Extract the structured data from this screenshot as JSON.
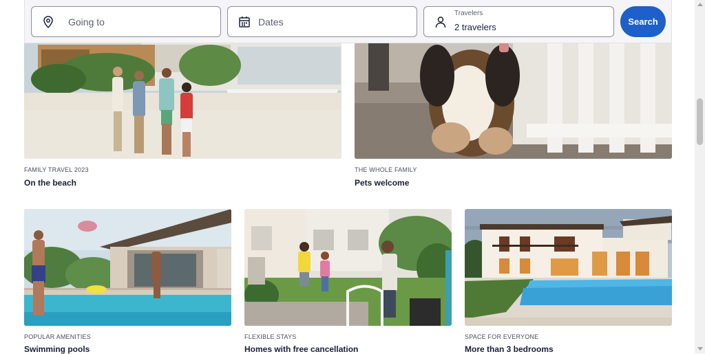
{
  "search": {
    "destination_placeholder": "Going to",
    "dates_label": "Dates",
    "travelers_label": "Travelers",
    "travelers_value": "2 travelers",
    "search_button": "Search"
  },
  "cards": [
    {
      "kicker": "FAMILY TRAVEL 2023",
      "title": "On the beach"
    },
    {
      "kicker": "THE WHOLE FAMILY",
      "title": "Pets welcome"
    },
    {
      "kicker": "POPULAR AMENITIES",
      "title": "Swimming pools"
    },
    {
      "kicker": "FLEXIBLE STAYS",
      "title": "Homes with free cancellation"
    },
    {
      "kicker": "SPACE FOR EVERYONE",
      "title": "More than 3 bedrooms"
    }
  ],
  "icons": {
    "destination": "map-pin-icon",
    "dates": "calendar-icon",
    "travelers": "person-icon"
  },
  "colors": {
    "search_button": "#1e5fc9",
    "text_primary": "#191e3b"
  }
}
